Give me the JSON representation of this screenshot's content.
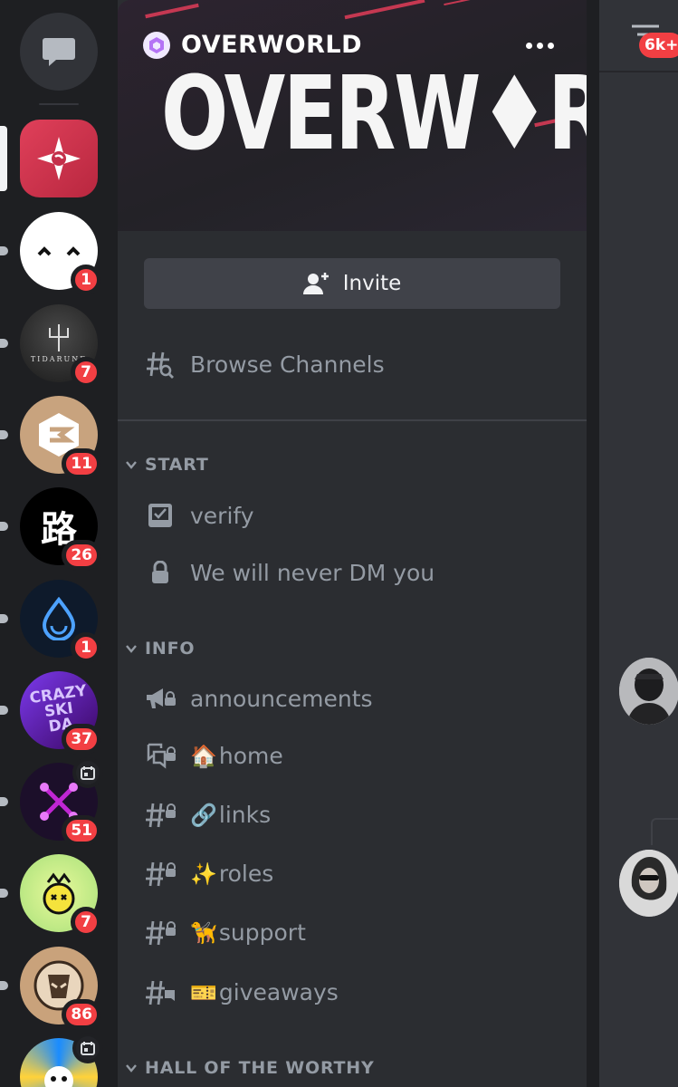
{
  "server_rail": {
    "dm_icon": "chat-bubble-icon",
    "servers": [
      {
        "name": "overworld-server",
        "colors": [
          "#e0405a",
          "#b8273f"
        ],
        "badge": "",
        "active": true
      },
      {
        "name": "sleepy-face-server",
        "colors": [
          "#ffffff"
        ],
        "badge": "1"
      },
      {
        "name": "tidarune-server",
        "colors": [
          "#2a2a2a"
        ],
        "badge": "7",
        "icon_text": "TIDARUNE"
      },
      {
        "name": "e-logo-server",
        "colors": [
          "#c8a37e"
        ],
        "badge": "11"
      },
      {
        "name": "lu-server",
        "colors": [
          "#000000"
        ],
        "badge": "26",
        "icon_text": "路"
      },
      {
        "name": "sui-drop-server",
        "colors": [
          "#0e1a2b"
        ],
        "badge": "1"
      },
      {
        "name": "crazy-ski-day-server",
        "colors": [
          "#4c1d95"
        ],
        "badge": "37",
        "icon_text": "CRAZY SKI DA"
      },
      {
        "name": "purple-x-server",
        "colors": [
          "#1c0f2a"
        ],
        "badge": "51",
        "event": true
      },
      {
        "name": "crown-face-server",
        "colors": [
          "#d7f07c"
        ],
        "badge": "7"
      },
      {
        "name": "helmet-server",
        "colors": [
          "#c9a27b"
        ],
        "badge": "86"
      },
      {
        "name": "cartoon-server",
        "colors": [
          "#1a8cff"
        ],
        "badge": "",
        "event": true
      }
    ]
  },
  "server_header": {
    "name": "OVERWORLD",
    "banner_logo": "OVERW♦RLD",
    "accent": "#e03c58"
  },
  "invite_button": {
    "label": "Invite"
  },
  "browse_channels": {
    "label": "Browse Channels"
  },
  "categories": {
    "start": {
      "name": "START",
      "channels": {
        "verify": {
          "name": "verify"
        },
        "never_dm": {
          "name": "We will never DM you"
        }
      }
    },
    "info": {
      "name": "INFO",
      "channels": {
        "announcements": {
          "name": "announcements"
        },
        "home": {
          "emoji": "🏠",
          "name": "home"
        },
        "links": {
          "emoji": "🔗",
          "name": "links"
        },
        "roles": {
          "emoji": "✨",
          "name": "roles"
        },
        "support": {
          "emoji": "🦮",
          "name": "support"
        },
        "giveaways": {
          "emoji": "🎫",
          "name": "giveaways"
        }
      }
    },
    "hall": {
      "name": "HALL OF THE WORTHY"
    }
  },
  "chat": {
    "member_list_badge": "6k+"
  }
}
